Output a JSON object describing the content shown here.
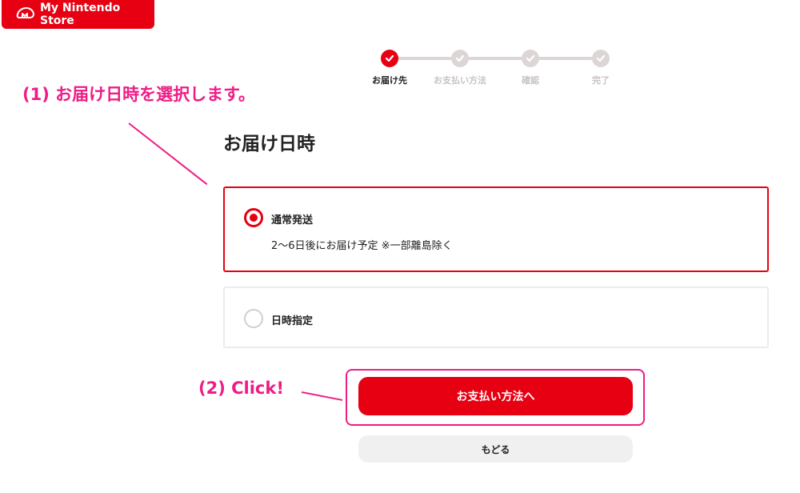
{
  "brand": {
    "logo_text": "My Nintendo Store",
    "accent": "#e60012",
    "annotation_color": "#ee1d85"
  },
  "stepper": {
    "steps": [
      {
        "label": "お届け先",
        "state": "current"
      },
      {
        "label": "お支払い方法",
        "state": "pending"
      },
      {
        "label": "確認",
        "state": "pending"
      },
      {
        "label": "完了",
        "state": "pending"
      }
    ]
  },
  "annotations": {
    "step1": "(1) お届け日時を選択します。",
    "step2": "(2) Click!"
  },
  "section": {
    "title": "お届け日時"
  },
  "options": [
    {
      "label": "通常発送",
      "sub": "2〜6日後にお届け予定 ※一部離島除く",
      "selected": true
    },
    {
      "label": "日時指定",
      "selected": false
    }
  ],
  "buttons": {
    "primary": "お支払い方法へ",
    "back": "もどる"
  }
}
